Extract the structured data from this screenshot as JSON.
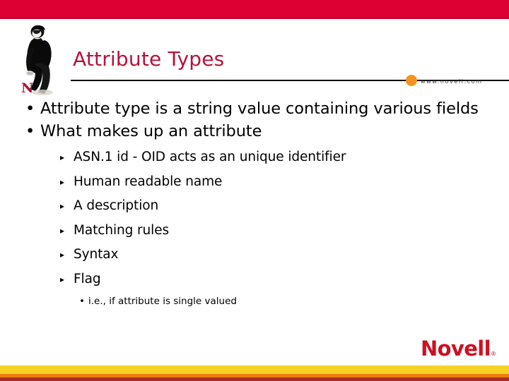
{
  "slide": {
    "title": "Attribute Types",
    "url_label": "www.novell.com",
    "brand": "Novell",
    "brand_reg": "®",
    "logo_letter": "N"
  },
  "colors": {
    "top_band": "#dd0033",
    "top_band_edge": "#c30230",
    "title": "#b5123c",
    "url_dot": "#f5921e",
    "brand": "#cc1122",
    "band_yellow": "#f5d223",
    "band_orange": "#ef7d11",
    "band_darkred": "#a83020",
    "body_text": "#000000"
  },
  "markers": {
    "level1": "•",
    "level2": "▸",
    "level3": "•"
  },
  "content": {
    "level1": [
      "Attribute type is a string value containing various fields",
      "What makes up an attribute"
    ],
    "level2": [
      "ASN.1 id - OID acts as an unique identifier",
      "Human readable name",
      "A description",
      "Matching rules",
      "Syntax",
      "Flag"
    ],
    "level3": [
      "i.e., if attribute is single valued"
    ]
  }
}
